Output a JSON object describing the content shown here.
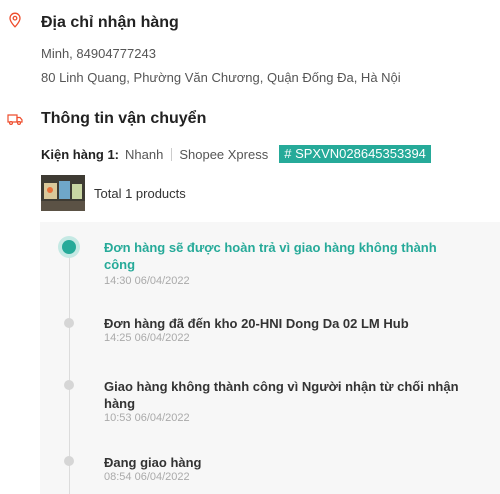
{
  "address": {
    "title": "Địa chỉ nhận hàng",
    "icon": "location-pin-icon",
    "name_phone": "Minh, 84904777243",
    "street": "80 Linh Quang, Phường Văn Chương, Quận Đống Đa, Hà Nội"
  },
  "shipping": {
    "title": "Thông tin vận chuyển",
    "icon": "delivery-truck-icon",
    "parcel_label": "Kiện hàng 1:",
    "speed": "Nhanh",
    "carrier": "Shopee Xpress",
    "tracking_code": "# SPXVN028645353394",
    "products_summary": "Total 1 products"
  },
  "timeline": [
    {
      "text": "Đơn hàng sẽ được hoàn trả vì giao hàng không thành công",
      "time": "14:30 06/04/2022",
      "active": true
    },
    {
      "text": "Đơn hàng đã đến kho 20-HNI Dong Da 02 LM Hub",
      "time": "14:25 06/04/2022",
      "active": false
    },
    {
      "text": "Giao hàng không thành công vì Người nhận từ chối nhận hàng",
      "time": "10:53 06/04/2022",
      "active": false
    },
    {
      "text": "Đang giao hàng",
      "time": "08:54 06/04/2022",
      "active": false
    }
  ],
  "colors": {
    "accent_orange": "#ee4d2d",
    "accent_teal": "#26aa99"
  }
}
